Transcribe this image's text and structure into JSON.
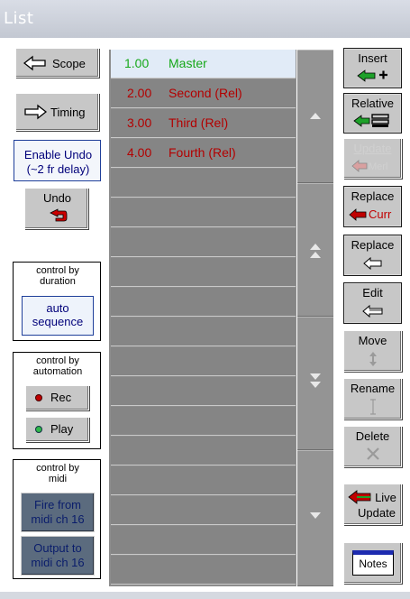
{
  "window": {
    "title": "List"
  },
  "left": {
    "scope": "Scope",
    "timing": "Timing",
    "enable_undo": [
      "Enable Undo",
      "(~2 fr delay)"
    ],
    "undo": "Undo",
    "group_duration": {
      "label": [
        "control by",
        "duration"
      ],
      "button": [
        "auto",
        "sequence"
      ]
    },
    "group_automation": {
      "label": [
        "control by",
        "automation"
      ],
      "rec": "Rec",
      "play": "Play"
    },
    "group_midi": {
      "label": [
        "control by",
        "midi"
      ],
      "fire": [
        "Fire from",
        "midi ch 16"
      ],
      "output": [
        "Output to",
        "midi ch 16"
      ]
    }
  },
  "list": {
    "rows": [
      {
        "num": "1.00",
        "name": "Master",
        "style": "selected"
      },
      {
        "num": "2.00",
        "name": "Second (Rel)",
        "style": "red"
      },
      {
        "num": "3.00",
        "name": "Third (Rel)",
        "style": "red"
      },
      {
        "num": "4.00",
        "name": "Fourth (Rel)",
        "style": "red"
      }
    ],
    "empty_rows": 14
  },
  "right": {
    "insert": "Insert",
    "relative": "Relative",
    "update": "Update",
    "update_sub": "Merl",
    "replace_curr": "Replace",
    "replace_curr_sub": "Curr",
    "replace": "Replace",
    "edit": "Edit",
    "move": "Move",
    "rename": "Rename",
    "delete": "Delete",
    "live_update": [
      "Live",
      "Update"
    ],
    "notes": "Notes"
  },
  "colors": {
    "selected_row": "#e1ebf7",
    "green_text": "#16a81a",
    "red_text": "#b30000",
    "list_bg": "#858585"
  }
}
